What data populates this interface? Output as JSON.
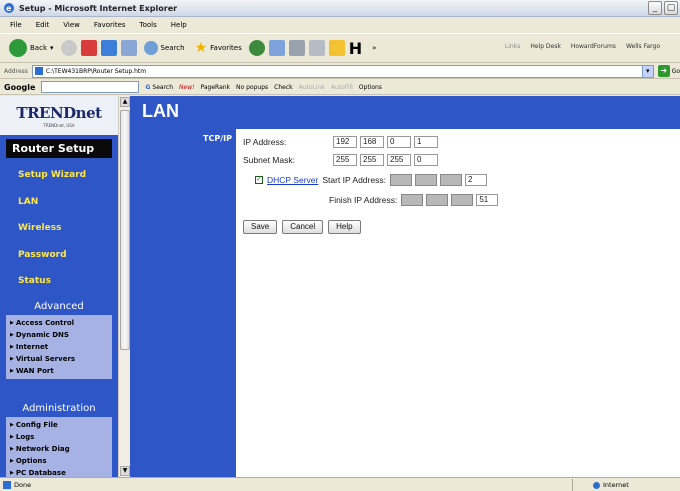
{
  "window": {
    "title": "Setup - Microsoft Internet Explorer",
    "minimize": "_",
    "maximize": "▢"
  },
  "menu": [
    "File",
    "Edit",
    "View",
    "Favorites",
    "Tools",
    "Help"
  ],
  "toolbar": {
    "back": "Back",
    "search": "Search",
    "favorites": "Favorites",
    "more": "»",
    "links_label": "Links",
    "links": [
      "Help Desk",
      "HowardForums",
      "Wells Fargo"
    ]
  },
  "address": {
    "label": "Address",
    "value": "C:\\TEW431BRP\\Router Setup.htm",
    "go": "Go"
  },
  "googlebar": {
    "logo": "Google",
    "search": "Search",
    "new_badge": "New!",
    "pagerank": "PageRank",
    "popups": "No popups",
    "check": "Check",
    "autolink": "AutoLink",
    "autofill": "AutoFill",
    "options": "Options"
  },
  "sidebar": {
    "logo": "TRENDnet",
    "logo_sub": "TRENDnet, USA",
    "router_setup": "Router Setup",
    "links": [
      "Setup Wizard",
      "LAN",
      "Wireless",
      "Password",
      "Status"
    ],
    "advanced_title": "Advanced",
    "advanced_items": [
      "Access Control",
      "Dynamic DNS",
      "Internet",
      "Virtual Servers",
      "WAN Port"
    ],
    "admin_title": "Administration",
    "admin_items": [
      "Config File",
      "Logs",
      "Network Diag",
      "Options",
      "PC Database"
    ]
  },
  "page": {
    "title": "LAN",
    "section": "TCP/IP",
    "ip_label": "IP Address:",
    "ip": [
      "192",
      "168",
      "0",
      "1"
    ],
    "mask_label": "Subnet Mask:",
    "mask": [
      "255",
      "255",
      "255",
      "0"
    ],
    "dhcp_label": "DHCP Server",
    "dhcp_checked": "✓",
    "start_label": "Start IP Address:",
    "start_last": "2",
    "finish_label": "Finish IP Address:",
    "finish_last": "51",
    "save": "Save",
    "cancel": "Cancel",
    "help": "Help"
  },
  "status": {
    "left": "Done",
    "zone": "Internet"
  },
  "colors": {
    "sidebar_blue": "#2e56c6",
    "link_yellow": "#ffe84a",
    "submenu_bg": "#a6b2e4"
  }
}
